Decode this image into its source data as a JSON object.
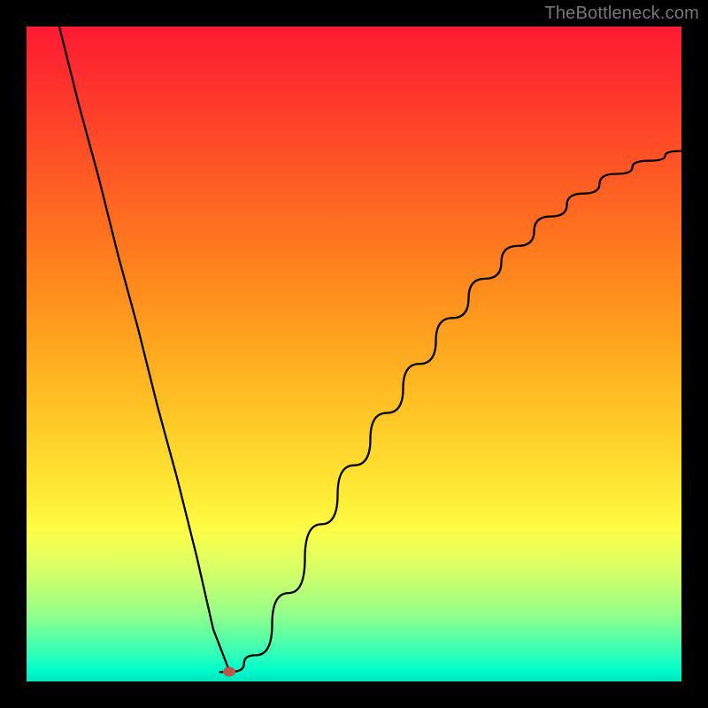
{
  "watermark": "TheBottleneck.com",
  "chart_data": {
    "type": "line",
    "title": "",
    "xlabel": "",
    "ylabel": "",
    "xlim": [
      0,
      1
    ],
    "ylim": [
      0,
      1
    ],
    "series": [
      {
        "name": "curve",
        "x": [
          0.05,
          0.08,
          0.11,
          0.14,
          0.17,
          0.2,
          0.23,
          0.26,
          0.285,
          0.31,
          0.35,
          0.4,
          0.45,
          0.5,
          0.55,
          0.6,
          0.65,
          0.7,
          0.75,
          0.8,
          0.85,
          0.9,
          0.95,
          1.0
        ],
        "y": [
          1.0,
          0.88,
          0.77,
          0.65,
          0.54,
          0.42,
          0.31,
          0.19,
          0.08,
          0.015,
          0.04,
          0.135,
          0.24,
          0.33,
          0.41,
          0.485,
          0.555,
          0.615,
          0.665,
          0.71,
          0.745,
          0.775,
          0.795,
          0.81
        ]
      }
    ],
    "marker": {
      "x": 0.31,
      "y": 0.015
    },
    "gradient_stops": [
      {
        "pos": 0.0,
        "color": "#ff1a33"
      },
      {
        "pos": 0.5,
        "color": "#ffa41f"
      },
      {
        "pos": 0.75,
        "color": "#fff942"
      },
      {
        "pos": 1.0,
        "color": "#00e6bf"
      }
    ]
  }
}
